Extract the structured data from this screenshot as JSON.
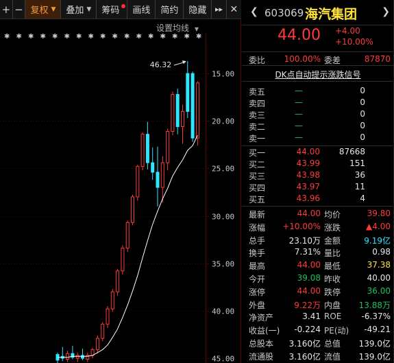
{
  "toolbar": {
    "plus": "+",
    "minus": "−",
    "items": [
      {
        "label": "复权",
        "caret": "▼",
        "active": true
      },
      {
        "label": "叠加",
        "caret": "▼"
      },
      {
        "label": "筹码",
        "dot": true
      },
      {
        "label": "画线"
      },
      {
        "label": "简约"
      },
      {
        "label": "隐藏"
      }
    ],
    "more": "▸▸",
    "close": "✕"
  },
  "chart": {
    "setting_label": "设置均线",
    "setting_caret": "▼",
    "high_label": "46.32",
    "markers": "✱",
    "y_ticks": [
      "45.00",
      "40.00",
      "35.00",
      "30.00",
      "25.00",
      "20.00",
      "15.00"
    ]
  },
  "chart_data": {
    "type": "candlestick",
    "ylim": [
      14.5,
      49.2
    ],
    "y_ticks": [
      15,
      20,
      25,
      30,
      35,
      40,
      45
    ],
    "candles": [
      {
        "o": 14.8,
        "h": 15.6,
        "l": 14.5,
        "c": 15.4,
        "up": false
      },
      {
        "o": 15.2,
        "h": 16.2,
        "l": 14.7,
        "c": 15.0,
        "up": false
      },
      {
        "o": 14.9,
        "h": 15.8,
        "l": 14.6,
        "c": 15.5,
        "up": true
      },
      {
        "o": 15.5,
        "h": 16.3,
        "l": 14.9,
        "c": 15.1,
        "up": false
      },
      {
        "o": 15.0,
        "h": 15.6,
        "l": 14.6,
        "c": 15.3,
        "up": true
      },
      {
        "o": 15.3,
        "h": 16.0,
        "l": 14.8,
        "c": 15.0,
        "up": false
      },
      {
        "o": 14.9,
        "h": 15.6,
        "l": 14.6,
        "c": 15.3,
        "up": true
      },
      {
        "o": 15.3,
        "h": 16.1,
        "l": 15.0,
        "c": 15.9,
        "up": true
      },
      {
        "o": 15.9,
        "h": 17.4,
        "l": 15.5,
        "c": 17.1,
        "up": true
      },
      {
        "o": 17.1,
        "h": 18.8,
        "l": 16.8,
        "c": 18.6,
        "up": true
      },
      {
        "o": 18.6,
        "h": 20.5,
        "l": 18.2,
        "c": 20.2,
        "up": true
      },
      {
        "o": 20.2,
        "h": 22.3,
        "l": 19.9,
        "c": 22.0,
        "up": true
      },
      {
        "o": 22.0,
        "h": 24.4,
        "l": 21.6,
        "c": 24.2,
        "up": true
      },
      {
        "o": 24.2,
        "h": 26.9,
        "l": 23.8,
        "c": 26.6,
        "up": true
      },
      {
        "o": 26.6,
        "h": 29.5,
        "l": 26.2,
        "c": 29.3,
        "up": true
      },
      {
        "o": 29.3,
        "h": 32.2,
        "l": 29.0,
        "c": 32.0,
        "up": true
      },
      {
        "o": 32.0,
        "h": 35.4,
        "l": 31.6,
        "c": 35.2,
        "up": true
      },
      {
        "o": 35.2,
        "h": 38.8,
        "l": 34.8,
        "c": 38.6,
        "up": true
      },
      {
        "o": 38.6,
        "h": 39.9,
        "l": 34.9,
        "c": 35.6,
        "up": false
      },
      {
        "o": 35.6,
        "h": 37.2,
        "l": 33.8,
        "c": 34.6,
        "up": false
      },
      {
        "o": 34.6,
        "h": 37.3,
        "l": 31.0,
        "c": 33.0,
        "up": false
      },
      {
        "o": 33.0,
        "h": 36.3,
        "l": 31.4,
        "c": 35.6,
        "up": true
      },
      {
        "o": 35.6,
        "h": 39.2,
        "l": 34.8,
        "c": 38.9,
        "up": true
      },
      {
        "o": 38.9,
        "h": 43.1,
        "l": 38.5,
        "c": 42.8,
        "up": true
      },
      {
        "o": 42.8,
        "h": 43.4,
        "l": 38.6,
        "c": 39.4,
        "up": false
      },
      {
        "o": 39.4,
        "h": 41.7,
        "l": 37.6,
        "c": 41.0,
        "up": true
      },
      {
        "o": 41.0,
        "h": 46.3,
        "l": 40.3,
        "c": 45.0,
        "up": false
      },
      {
        "o": 45.0,
        "h": 45.2,
        "l": 37.8,
        "c": 38.2,
        "up": false
      },
      {
        "o": 38.2,
        "h": 44.2,
        "l": 37.4,
        "c": 44.0,
        "up": true
      }
    ],
    "ma": [
      15.1,
      15.1,
      15.1,
      15.2,
      15.2,
      15.2,
      15.2,
      15.3,
      15.6,
      15.9,
      16.4,
      17.2,
      18.1,
      19.3,
      20.6,
      22.1,
      23.7,
      25.6,
      27.4,
      29.1,
      30.5,
      31.8,
      32.9,
      34.2,
      35.1,
      35.9,
      36.9,
      37.4,
      38.5
    ]
  },
  "quote": {
    "nav_left": "❮",
    "nav_right": "❯",
    "code": "603069",
    "name": "海汽集团",
    "price": "44.00",
    "change": "+4.00",
    "change_pct": "+10.00%",
    "wei_bi_label": "委比",
    "wei_bi": "100.00%",
    "wei_cha_label": "委差",
    "wei_cha": "87870",
    "dk_link": "DK点自动提示涨跌信号",
    "sell": [
      {
        "label": "卖五",
        "price": "—",
        "vol": "0"
      },
      {
        "label": "卖四",
        "price": "—",
        "vol": "0"
      },
      {
        "label": "卖三",
        "price": "—",
        "vol": "0"
      },
      {
        "label": "卖二",
        "price": "—",
        "vol": "0"
      },
      {
        "label": "卖一",
        "price": "—",
        "vol": "0"
      }
    ],
    "buy": [
      {
        "label": "买一",
        "price": "44.00",
        "vol": "87668"
      },
      {
        "label": "买二",
        "price": "43.99",
        "vol": "151"
      },
      {
        "label": "买三",
        "price": "43.98",
        "vol": "36"
      },
      {
        "label": "买四",
        "price": "43.97",
        "vol": "11"
      },
      {
        "label": "买五",
        "price": "43.96",
        "vol": "4"
      }
    ],
    "stats": [
      {
        "k1": "最新",
        "v1": "44.00",
        "c1": "red",
        "k2": "均价",
        "v2": "39.80",
        "c2": "red"
      },
      {
        "k1": "涨幅",
        "v1": "+10.00%",
        "c1": "red",
        "k2": "涨跌",
        "v2": "▲4.00",
        "c2": "red"
      },
      {
        "k1": "总手",
        "v1": "23.10万",
        "c1": "white",
        "k2": "金额",
        "v2": "9.19亿",
        "c2": "cyan"
      },
      {
        "k1": "换手",
        "v1": "7.31%",
        "c1": "white",
        "k2": "量比",
        "v2": "0.98",
        "c2": "white"
      },
      {
        "k1": "最高",
        "v1": "44.00",
        "c1": "red",
        "k2": "最低",
        "v2": "37.38",
        "c2": "yellow"
      },
      {
        "k1": "今开",
        "v1": "39.08",
        "c1": "green",
        "k2": "昨收",
        "v2": "40.00",
        "c2": "white"
      },
      {
        "k1": "涨停",
        "v1": "44.00",
        "c1": "red",
        "k2": "跌停",
        "v2": "36.00",
        "c2": "green"
      },
      {
        "k1": "外盘",
        "v1": "9.22万",
        "c1": "red",
        "k2": "内盘",
        "v2": "13.88万",
        "c2": "green"
      },
      {
        "k1": "净资产",
        "v1": "3.41",
        "c1": "white",
        "k2": "ROE",
        "v2": "-6.37%",
        "c2": "white"
      },
      {
        "k1": "收益(一)",
        "v1": "-0.224",
        "c1": "white",
        "k2": "PE(动)",
        "v2": "-49.21",
        "c2": "white"
      },
      {
        "k1": "总股本",
        "v1": "3.160亿",
        "c1": "white",
        "k2": "总值",
        "v2": "139.0亿",
        "c2": "white"
      },
      {
        "k1": "流通股",
        "v1": "3.160亿",
        "c1": "white",
        "k2": "流值",
        "v2": "139.0亿",
        "c2": "white"
      }
    ]
  },
  "colors": {
    "up": "#ff3b3b",
    "down": "#2ee6ff",
    "ma": "#ffffff",
    "grid": "#5a0000",
    "accent": "#f59a3a"
  }
}
